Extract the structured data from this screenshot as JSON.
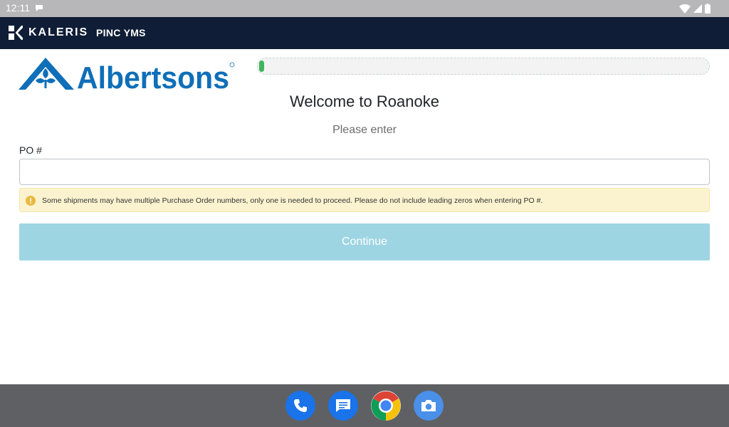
{
  "status_bar": {
    "time": "12:11"
  },
  "header": {
    "brand": "KALERIS",
    "app_name": "PINC YMS"
  },
  "logo": {
    "text": "Albertsons"
  },
  "progress": {
    "fraction": 0.01
  },
  "main": {
    "welcome": "Welcome to Roanoke",
    "prompt": "Please enter",
    "po_label": "PO #",
    "po_value": "",
    "notice": "Some shipments may have multiple Purchase Order numbers, only one is needed to proceed. Please do not include leading zeros when entering PO #.",
    "continue_label": "Continue"
  },
  "dock": {
    "apps": [
      "phone-icon",
      "messages-icon",
      "chrome-icon",
      "camera-icon"
    ]
  },
  "colors": {
    "header_bg": "#0f1d36",
    "albertsons_blue": "#0f6fb8",
    "progress_green": "#3fb55e",
    "continue_disabled": "#9dd5e3",
    "notice_bg": "#fbf3cf"
  }
}
